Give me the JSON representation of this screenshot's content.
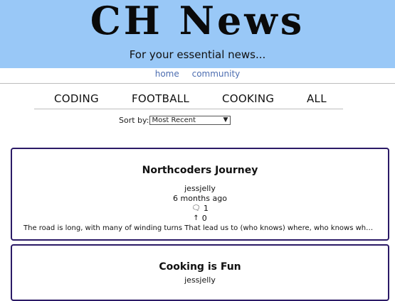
{
  "header": {
    "title": "CH News",
    "tagline": "For your essential news..."
  },
  "nav": {
    "home": "home",
    "community": "community"
  },
  "topics": [
    "CODING",
    "FOOTBALL",
    "COOKING",
    "ALL"
  ],
  "sort": {
    "label": "Sort by:",
    "selected": "Most Recent"
  },
  "articles": [
    {
      "title": "Northcoders Journey",
      "author": "jessjelly",
      "date": "6 months ago",
      "comment_count": "1",
      "votes": "0",
      "body": "The road is long, with many of winding turns That lead us to (who knows) where, who knows where? Bu…"
    },
    {
      "title": "Cooking is Fun",
      "author": "jessjelly"
    }
  ],
  "icons": {
    "comments": "comments-icon",
    "votes": "arrow-up-icon"
  },
  "colors": {
    "header_bg": "#99c8f7",
    "link": "#4c6db0",
    "card_border": "#2b1a66"
  }
}
